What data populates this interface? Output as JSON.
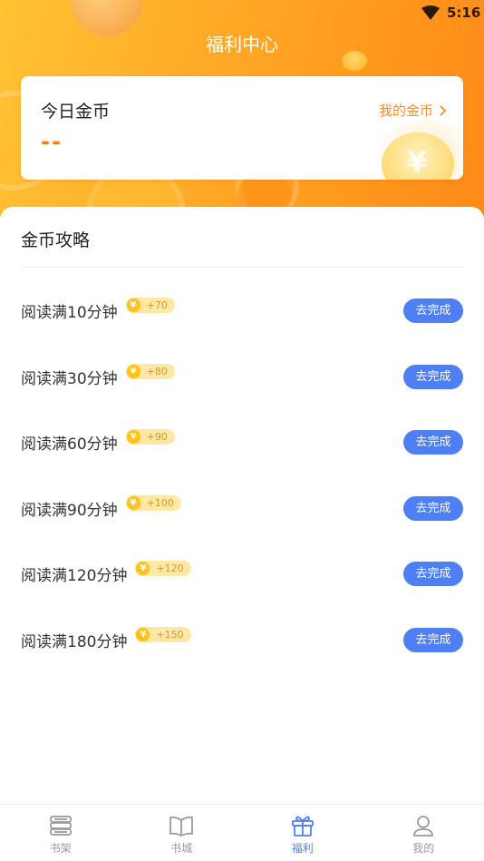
{
  "status_bar": {
    "time": "5:16"
  },
  "header": {
    "title": "福利中心"
  },
  "coins_card": {
    "title": "今日金币",
    "value": "--",
    "link_label": "我的金币"
  },
  "strategy": {
    "title": "金币攻略",
    "tasks": [
      {
        "label": "阅读满10分钟",
        "reward": "+70",
        "button": "去完成"
      },
      {
        "label": "阅读满30分钟",
        "reward": "+80",
        "button": "去完成"
      },
      {
        "label": "阅读满60分钟",
        "reward": "+90",
        "button": "去完成"
      },
      {
        "label": "阅读满90分钟",
        "reward": "+100",
        "button": "去完成"
      },
      {
        "label": "阅读满120分钟",
        "reward": "+120",
        "button": "去完成"
      },
      {
        "label": "阅读满180分钟",
        "reward": "+150",
        "button": "去完成"
      }
    ],
    "coin_symbol": "¥"
  },
  "tabbar": {
    "items": [
      {
        "label": "书架",
        "icon": "bookshelf-icon"
      },
      {
        "label": "书城",
        "icon": "open-book-icon"
      },
      {
        "label": "福利",
        "icon": "gift-icon",
        "active": true
      },
      {
        "label": "我的",
        "icon": "profile-icon"
      }
    ]
  },
  "colors": {
    "accent": "#4f7ff5",
    "orange": "#ff8a18",
    "coin_value": "#ff7a1a"
  }
}
